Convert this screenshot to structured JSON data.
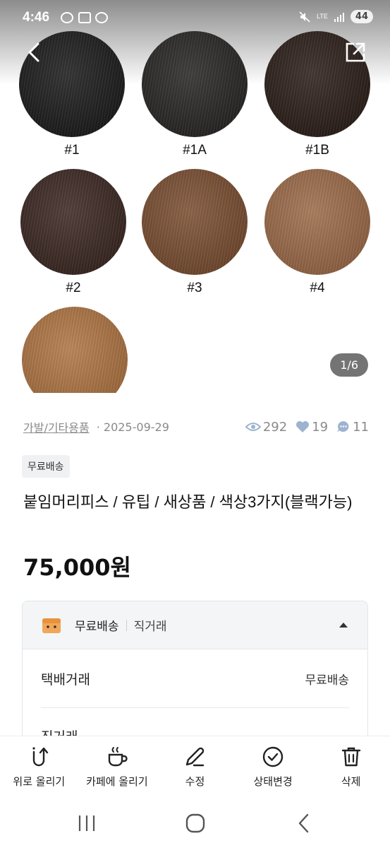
{
  "status_bar": {
    "time": "4:46",
    "battery": "44"
  },
  "gallery": {
    "swatches": [
      {
        "label": "#1",
        "color": "#1e1e1e"
      },
      {
        "label": "#1A",
        "color": "#2b2927"
      },
      {
        "label": "#1B",
        "color": "#2e211b"
      },
      {
        "label": "#2",
        "color": "#3e2a24"
      },
      {
        "label": "#3",
        "color": "#7d5134"
      },
      {
        "label": "#4",
        "color": "#a06e4c"
      },
      {
        "label": "",
        "color": "#b37846"
      }
    ],
    "counter": "1/6"
  },
  "meta": {
    "category": "가발/기타용품",
    "date": "2025-09-29",
    "views": "292",
    "likes": "19",
    "chats": "11"
  },
  "badge": "무료배송",
  "title": "붙임머리피스 / 유팁 / 새상품 / 색상3가지(블랙가능)",
  "price": "75,000원",
  "shipping": {
    "header_main": "무료배송",
    "header_sub": "직거래",
    "row1_label": "택배거래",
    "row1_value": "무료배송",
    "row2_label": "직거래"
  },
  "actions": [
    {
      "label": "위로 올리기",
      "icon": "bump-up-icon"
    },
    {
      "label": "카페에 올리기",
      "icon": "coffee-cup-icon"
    },
    {
      "label": "수정",
      "icon": "pencil-icon"
    },
    {
      "label": "상태변경",
      "icon": "check-circle-icon"
    },
    {
      "label": "삭제",
      "icon": "trash-icon"
    }
  ],
  "colors": {
    "accent_icon": "#9db3d0",
    "text_muted": "#8a8a8a"
  }
}
